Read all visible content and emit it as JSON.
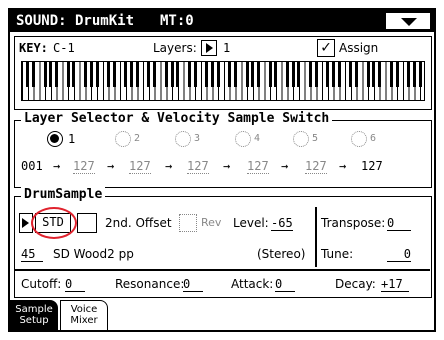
{
  "title": "SOUND: DrumKit",
  "mt": "MT:0",
  "key": {
    "label": "KEY:",
    "value": "C-1"
  },
  "layers": {
    "label": "Layers:",
    "value": "1"
  },
  "assign_label": "Assign",
  "assign_checked": "✓",
  "layer_section": {
    "title": "Layer Selector & Velocity Sample Switch",
    "layers": [
      "1",
      "2",
      "3",
      "4",
      "5",
      "6"
    ],
    "velocity_start": "001",
    "velocity_splits": [
      "127",
      "127",
      "127",
      "127",
      "127"
    ],
    "velocity_end": "127",
    "arrow": "→"
  },
  "drum_section": {
    "title": "DrumSample",
    "std_label": "STD",
    "offset_label": "2nd. Offset",
    "rev_label": "Rev",
    "level_label": "Level:",
    "level_value": "-65",
    "transpose_label": "Transpose:",
    "transpose_value": "0",
    "sample_number": "45",
    "sample_name": "SD Wood2 pp",
    "stereo": "(Stereo)",
    "tune_label": "Tune:",
    "tune_value": "0",
    "cutoff_label": "Cutoff:",
    "cutoff_value": "0",
    "resonance_label": "Resonance:",
    "resonance_value": "0",
    "attack_label": "Attack:",
    "attack_value": "0",
    "decay_label": "Decay:",
    "decay_value": "+17"
  },
  "tabs": [
    {
      "line1": "Sample",
      "line2": "Setup"
    },
    {
      "line1": "Voice",
      "line2": "Mixer"
    }
  ],
  "colors": {
    "highlight": "#e0232e"
  }
}
